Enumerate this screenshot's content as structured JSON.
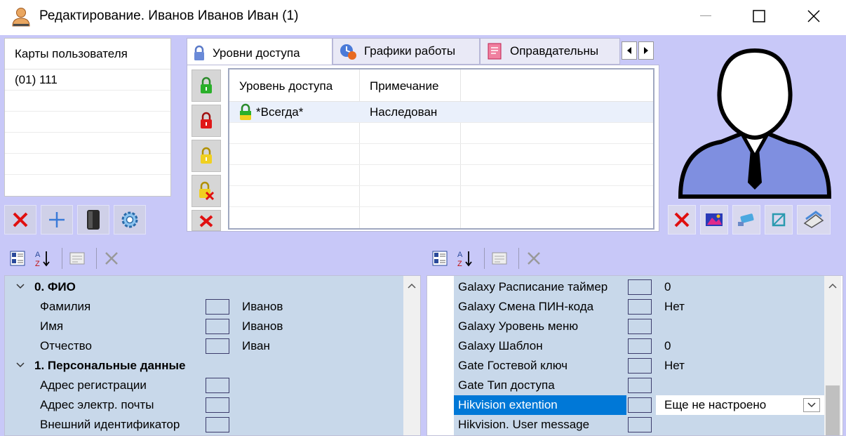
{
  "window": {
    "title": "Редактирование. Иванов Иванов  Иван (1)"
  },
  "cards": {
    "header": "Карты пользователя",
    "rows": [
      "(01) 111"
    ]
  },
  "tabs": [
    {
      "label": "Уровни доступа",
      "icon": "lock-icon",
      "active": true
    },
    {
      "label": "Графики работы",
      "icon": "schedule-icon",
      "active": false
    },
    {
      "label": "Оправдательны",
      "icon": "document-icon",
      "active": false
    }
  ],
  "access_grid": {
    "columns": [
      "Уровень доступа",
      "Примечание"
    ],
    "rows": [
      {
        "level": "*Всегда*",
        "note": "Наследован"
      }
    ]
  },
  "left_props": {
    "groups": [
      {
        "title": "0. ФИО",
        "rows": [
          {
            "name": "Фамилия",
            "value": "Иванов"
          },
          {
            "name": "Имя",
            "value": "Иванов"
          },
          {
            "name": "Отчество",
            "value": "Иван"
          }
        ]
      },
      {
        "title": "1. Персональные данные",
        "rows": [
          {
            "name": "Адрес регистрации",
            "value": ""
          },
          {
            "name": "Адрес электр. почты",
            "value": ""
          },
          {
            "name": "Внешний идентификатор",
            "value": ""
          }
        ]
      }
    ]
  },
  "right_props": {
    "rows": [
      {
        "name": "Galaxy Расписание таймер",
        "value": "0"
      },
      {
        "name": "Galaxy Смена ПИН-кода",
        "value": "Нет"
      },
      {
        "name": "Galaxy Уровень меню",
        "value": ""
      },
      {
        "name": "Galaxy Шаблон",
        "value": "0"
      },
      {
        "name": "Gate Гостевой ключ",
        "value": "Нет"
      },
      {
        "name": "Gate Тип доступа",
        "value": ""
      },
      {
        "name": "Hikvision extention",
        "value": "Еще не настроено",
        "selected": true
      },
      {
        "name": "Hikvision. User message",
        "value": ""
      }
    ]
  },
  "colors": {
    "client_bg": "#c8c8f8",
    "row_blue": "#c8d8ea",
    "selected": "#0078d7"
  }
}
